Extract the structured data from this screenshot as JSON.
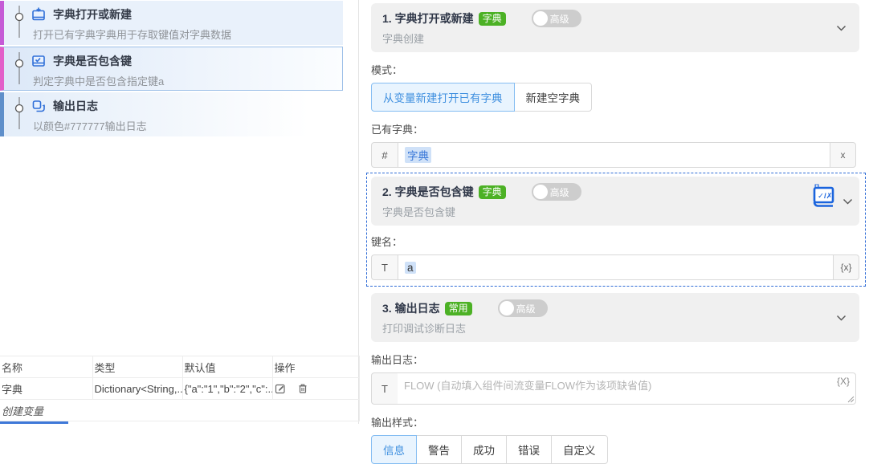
{
  "flow_list": {
    "steps": [
      {
        "title": "字典打开或新建",
        "subtitle": "打开已有字典字典用于存取键值对字典数据",
        "icon": "dictionary-add-icon",
        "accent_color": "#c55bd6",
        "selected": false
      },
      {
        "title": "字典是否包含键",
        "subtitle": "判定字典中是否包含指定键a",
        "icon": "dictionary-contains-icon",
        "accent_color": "#e25fc9",
        "selected": true
      },
      {
        "title": "输出日志",
        "subtitle": "以颜色#777777输出日志",
        "icon": "log-output-icon",
        "accent_color": "#5f8fca",
        "selected": false
      }
    ]
  },
  "variables_table": {
    "headers": [
      "名称",
      "类型",
      "默认值",
      "操作"
    ],
    "rows": [
      {
        "name": "字典",
        "type": "Dictionary<String,...",
        "default_value": "{\"a\":\"1\",\"b\":\"2\",\"c\":...",
        "actions": [
          "edit",
          "delete"
        ]
      }
    ],
    "footer_action": "创建变量"
  },
  "properties": {
    "advanced_label": "高级",
    "panels": [
      {
        "title": "1. 字典打开或新建",
        "badge": "字典",
        "subtitle": "字典创建",
        "mode_label": "模式：",
        "mode_options": [
          "从变量新建打开已有字典",
          "新建空字典"
        ],
        "mode_selected": "从变量新建打开已有字典",
        "dict_label": "已有字典：",
        "dict_prefix": "#",
        "dict_value": "字典",
        "dict_clear": "x"
      },
      {
        "title": "2. 字典是否包含键",
        "badge": "字典",
        "subtitle": "字典是否包含键",
        "selected": true,
        "key_label": "键名：",
        "key_prefix": "T",
        "key_value": "a",
        "key_suffix": "{x}"
      },
      {
        "title": "3. 输出日志",
        "badge": "常用",
        "subtitle": "打印调试诊断日志",
        "log_label": "输出日志：",
        "log_prefix": "T",
        "log_placeholder": "FLOW (自动填入组件间流变量FLOW作为该项缺省值)",
        "log_suffix": "{X}",
        "style_label": "输出样式：",
        "style_options": [
          "信息",
          "警告",
          "成功",
          "错误",
          "自定义"
        ],
        "style_selected": "信息"
      }
    ]
  },
  "colors": {
    "accent_blue": "#3f8fdf",
    "badge_green": "#4cb125",
    "selection_dashed_border": "#2e6bd6",
    "token_bg": "#cfe1f8",
    "token_var_text": "#3a78d8",
    "panel_header_bg": "#f0f0f0",
    "step1_accent": "#c55bd6",
    "step2_accent": "#e25fc9",
    "step3_accent": "#5f8fca",
    "step_bg": "#e9f1fb",
    "bottom_bar_blue": "#3e78d8",
    "icon_blue": "#1a64dd"
  }
}
